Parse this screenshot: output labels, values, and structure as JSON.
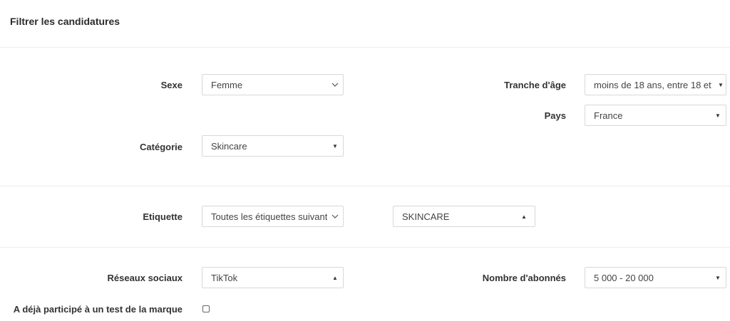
{
  "panel": {
    "title": "Filtrer les candidatures"
  },
  "filters": {
    "sexe": {
      "label": "Sexe",
      "value": "Femme"
    },
    "tranche_age": {
      "label": "Tranche d'âge",
      "value": "moins de 18 ans, entre 18 et"
    },
    "pays": {
      "label": "Pays",
      "value": "France"
    },
    "categorie": {
      "label": "Catégorie",
      "value": "Skincare"
    },
    "etiquette": {
      "label": "Etiquette",
      "mode": "Toutes les étiquettes suivantes",
      "value": "SKINCARE"
    },
    "reseaux": {
      "label": "Réseaux sociaux",
      "value": "TikTok"
    },
    "abonnes": {
      "label": "Nombre d'abonnés",
      "value": "5 000 - 20 000"
    },
    "deja_participe": {
      "label": "A déjà participé à un test de la marque",
      "checked": false
    }
  },
  "icons": {
    "caret_down": "▼",
    "caret_up": "▲",
    "chevron": "chevron-down-icon"
  }
}
